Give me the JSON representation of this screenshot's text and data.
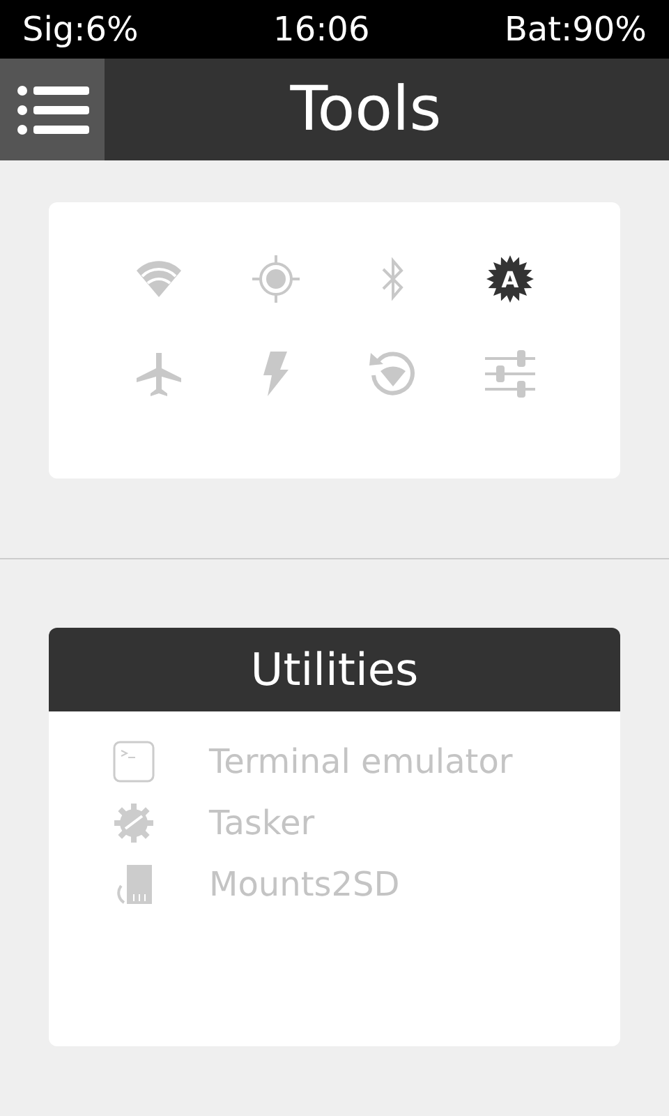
{
  "status_bar": {
    "signal": "Sig:6%",
    "time": "16:06",
    "battery": "Bat:90%"
  },
  "header": {
    "title": "Tools"
  },
  "toggles": [
    {
      "kind": "wifi",
      "on": false
    },
    {
      "kind": "location",
      "on": false
    },
    {
      "kind": "bluetooth",
      "on": false
    },
    {
      "kind": "auto-brightness",
      "on": true,
      "badge": "A"
    },
    {
      "kind": "airplane",
      "on": false
    },
    {
      "kind": "flash",
      "on": false
    },
    {
      "kind": "wifi-sync",
      "on": false
    },
    {
      "kind": "sliders",
      "on": false
    }
  ],
  "utilities": {
    "title": "Utilities",
    "items": [
      {
        "kind": "terminal",
        "label": "Terminal emulator"
      },
      {
        "kind": "gear",
        "label": "Tasker"
      },
      {
        "kind": "sdcard",
        "label": "Mounts2SD"
      }
    ]
  }
}
